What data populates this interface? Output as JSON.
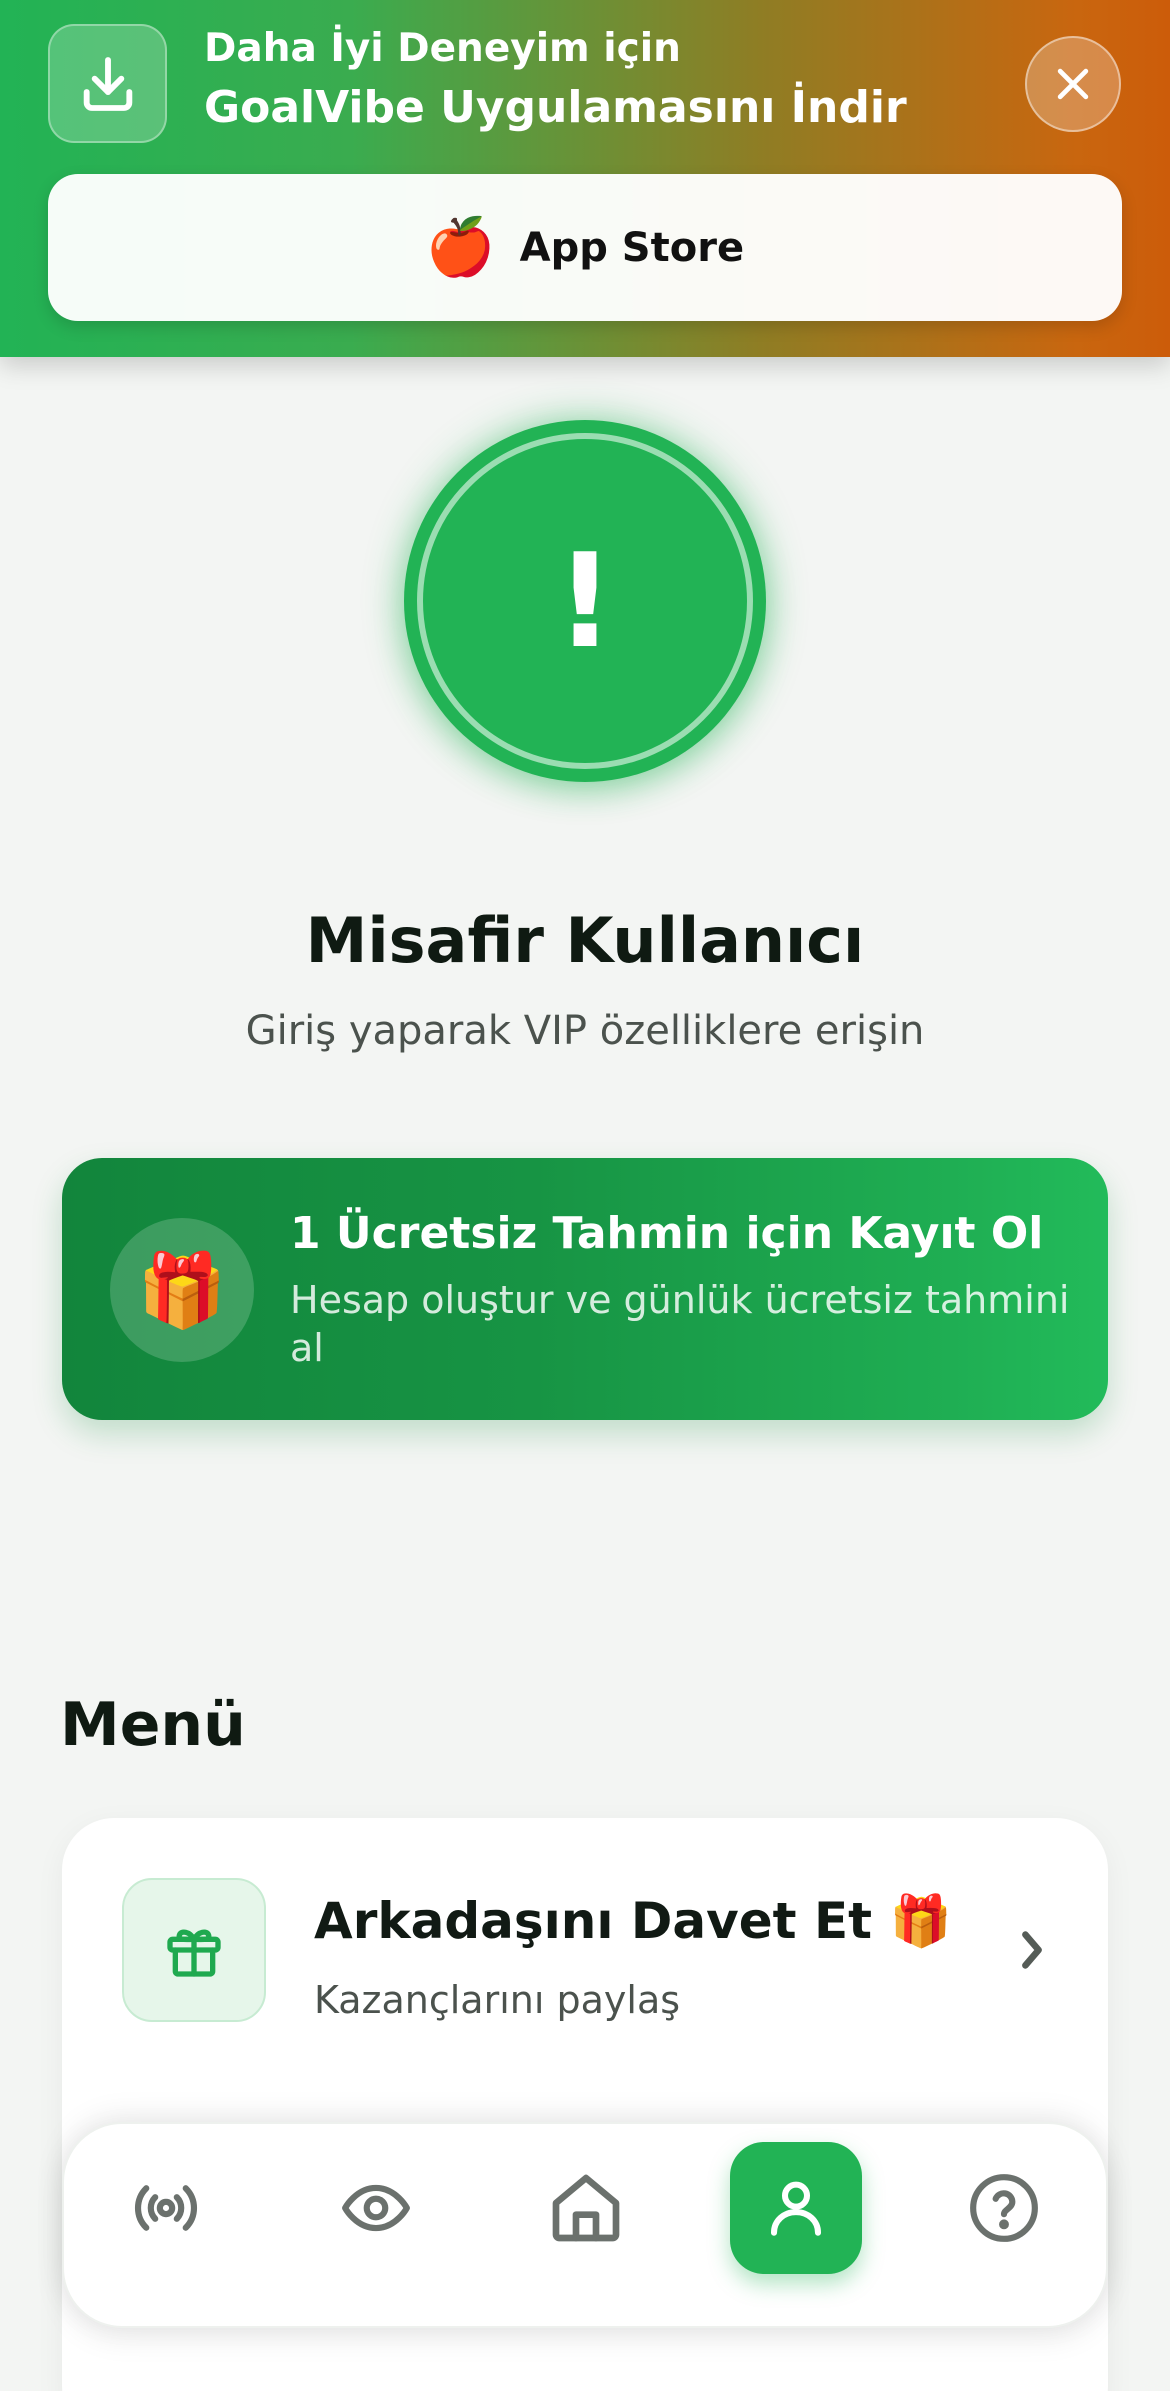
{
  "banner": {
    "line1": "Daha İyi Deneyim için",
    "line2": "GoalVibe Uygulamasını İndir",
    "store_label": "App Store",
    "store_emoji": "🍎",
    "download_icon": "download-icon",
    "close_icon": "close-icon"
  },
  "profile": {
    "avatar_icon": "exclamation-icon",
    "avatar_symbol": "!",
    "name": "Misafir Kullanıcı",
    "subtitle": "Giriş yaparak VIP özelliklere erişin"
  },
  "promo": {
    "emoji": "🎁",
    "title": "1 Ücretsiz Tahmin için Kayıt Ol",
    "subtitle": "Hesap oluştur ve günlük ücretsiz tahmini al"
  },
  "menu": {
    "title": "Menü",
    "items": [
      {
        "icon": "gift-icon",
        "title": "Arkadaşını Davet Et 🎁",
        "subtitle": "Kazançlarını paylaş"
      }
    ]
  },
  "bottom_nav": {
    "items": [
      {
        "icon": "live-broadcast-icon",
        "active": false
      },
      {
        "icon": "eye-icon",
        "active": false
      },
      {
        "icon": "home-icon",
        "active": false
      },
      {
        "icon": "user-icon",
        "active": true
      },
      {
        "icon": "help-icon",
        "active": false
      }
    ]
  },
  "colors": {
    "accent": "#22b355",
    "banner_gradient_start": "#22b355",
    "banner_gradient_end": "#cc5c0a",
    "background": "#f3f5f3"
  }
}
